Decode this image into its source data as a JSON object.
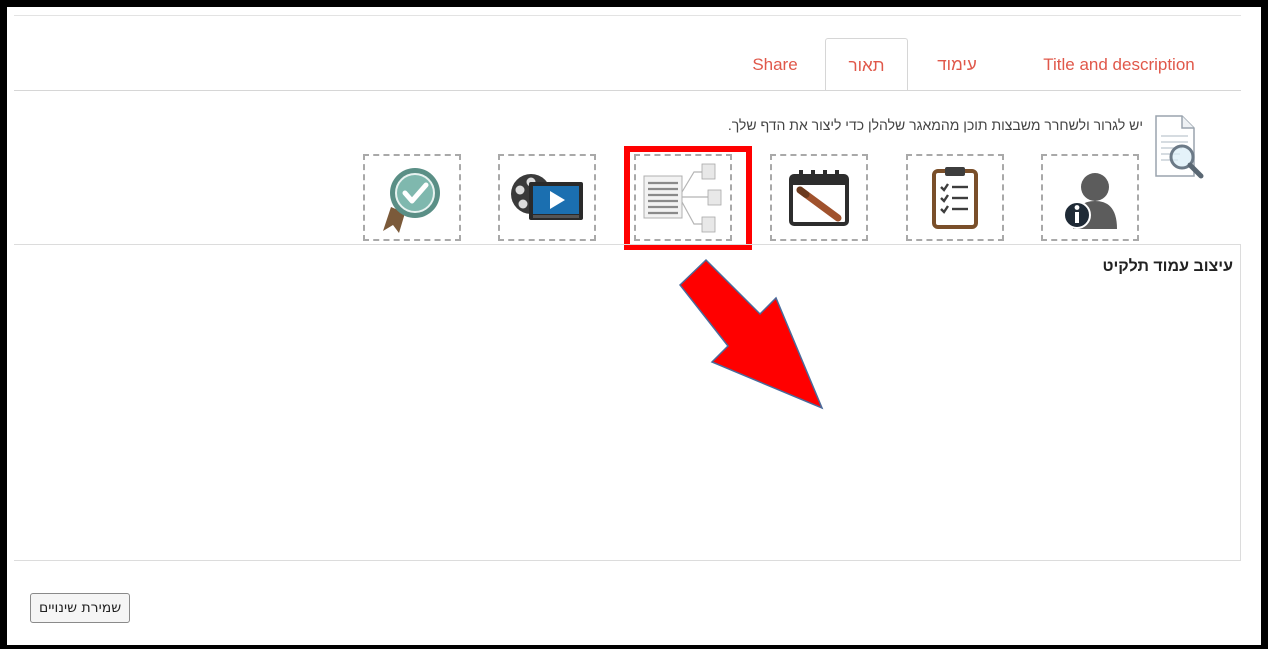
{
  "tabs": {
    "share": "Share",
    "description_he": "תאור",
    "layout_he": "עימוד",
    "title_and_description": "Title and description"
  },
  "content_blocks": {
    "intro_text": "יש לגרור ולשחרר משבצות תוכן מהמאגר שלהלן כדי ליצור את הדף שלך.",
    "items": [
      {
        "icon": "user-info-icon"
      },
      {
        "icon": "clipboard-checklist-icon"
      },
      {
        "icon": "calendar-pen-icon"
      },
      {
        "icon": "table-structure-icon"
      },
      {
        "icon": "film-video-icon"
      },
      {
        "icon": "badge-check-icon"
      }
    ]
  },
  "portfolio_layout": {
    "title": "עיצוב עמוד תלקיט"
  },
  "footer": {
    "save_label": "שמירת שינויים"
  },
  "annotation_colors": {
    "highlight": "#ff0000",
    "arrow_fill": "#ff0000",
    "arrow_stroke": "#4a6a9a"
  }
}
